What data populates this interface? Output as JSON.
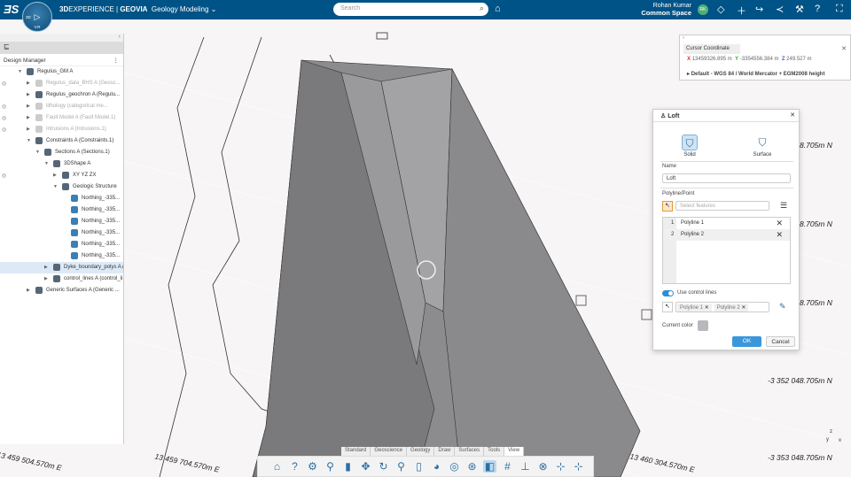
{
  "topbar": {
    "logo": "3DS",
    "brand_bold": "3D",
    "brand_rest": "EXPERIENCE | ",
    "brand_geovia": "GEOVIA",
    "app": "Geology Modeling",
    "search_placeholder": "Search",
    "user_name": "Rohan Kumar",
    "space": "Common Space",
    "avatar": "RK",
    "compass_labels": [
      "3D",
      "V.R"
    ]
  },
  "design_manager": {
    "title": "Design Manager",
    "items": [
      {
        "label": "Regulus_GM A",
        "depth": 0,
        "expanded": true,
        "dim": false
      },
      {
        "label": "Regulus_data_BHS A (Geosc...",
        "depth": 1,
        "dim": true,
        "hidden": true
      },
      {
        "label": "Regulus_geochron A (Regulu...",
        "depth": 1,
        "dim": false
      },
      {
        "label": "lithology (categorical me...",
        "depth": 1,
        "dim": true,
        "hidden": true
      },
      {
        "label": "Fault Model A (Fault Model.1)",
        "depth": 1,
        "dim": true,
        "hidden": true
      },
      {
        "label": "Intrusions A (Intrusions.1)",
        "depth": 1,
        "dim": true,
        "hidden": true
      },
      {
        "label": "Constraints A (Constraints.1)",
        "depth": 1,
        "expanded": true
      },
      {
        "label": "Sections A (Sections.1)",
        "depth": 2,
        "expanded": true
      },
      {
        "label": "3DShape A",
        "depth": 3,
        "expanded": true
      },
      {
        "label": "XY  YZ  ZX",
        "depth": 4,
        "hidden": true
      },
      {
        "label": "Geologic Structure",
        "depth": 4,
        "expanded": true
      },
      {
        "label": "Northing_-335...",
        "depth": 5
      },
      {
        "label": "Northing_-335...",
        "depth": 5
      },
      {
        "label": "Northing_-335...",
        "depth": 5
      },
      {
        "label": "Northing_-335...",
        "depth": 5
      },
      {
        "label": "Northing_-335...",
        "depth": 5
      },
      {
        "label": "Northing_-335...",
        "depth": 5
      },
      {
        "label": "Dyke_boundary_polys A (...",
        "depth": 3,
        "selected": true
      },
      {
        "label": "control_lines A (control_li...",
        "depth": 3
      },
      {
        "label": "Generic Surfaces A (Generic ...",
        "depth": 1
      }
    ]
  },
  "cursor_coordinate": {
    "title": "Cursor Coordinate",
    "x_label": "X",
    "x": "13459326.895 m",
    "y_label": "Y",
    "y": "-3354556.384 m",
    "z_label": "Z",
    "z": "249.527 m",
    "crs": "Default - WGS 84 / World Mercator + EGM2008 height"
  },
  "loft": {
    "title": "Loft",
    "mode_solid": "Solid",
    "mode_surface": "Surface",
    "name_label": "Name",
    "name_value": "Loft",
    "polyline_label": "Polyline/Point",
    "select_placeholder": "Select features",
    "list": [
      {
        "index": "1",
        "label": "Polyline 1"
      },
      {
        "index": "2",
        "label": "Polyline 2"
      }
    ],
    "use_control_lines": "Use control lines",
    "use_control_lines_on": true,
    "control_chips": [
      "Polyline 1",
      "Polyline 2"
    ],
    "current_color_label": "Current color",
    "current_color": "#b8b9bc",
    "ok": "OK",
    "cancel": "Cancel"
  },
  "viewport": {
    "labels_n": [
      "8.705m N",
      "8.705m N",
      "8.705m N",
      "-3 352 048.705m N",
      "-3 353 048.705m N"
    ],
    "labels_e": [
      "13 459 504.570m E",
      "13 459 704.570m E",
      "13 460 304.570m E"
    ],
    "axis": {
      "z": "z",
      "y": "y",
      "x": "x"
    }
  },
  "toolbar": {
    "tabs": [
      "Standard",
      "Geoscience",
      "Geology",
      "Draw",
      "Surfaces",
      "Tools",
      "View"
    ],
    "active_tab": "View"
  }
}
